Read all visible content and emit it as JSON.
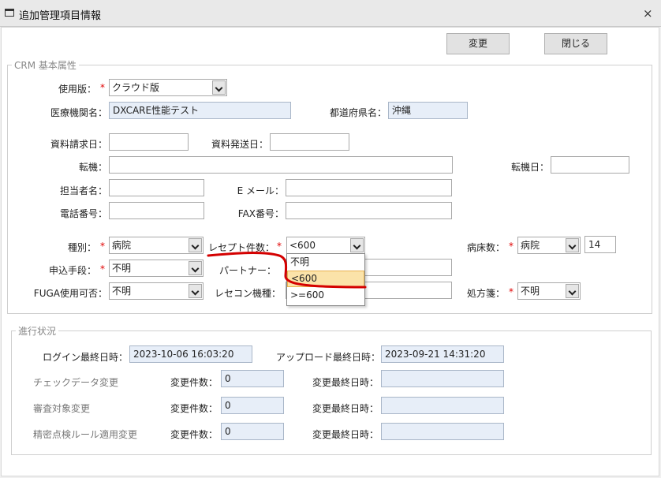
{
  "window": {
    "title": "追加管理項目情報",
    "close_icon": "×"
  },
  "toolbar": {
    "change_label": "変更",
    "close_label": "閉じる"
  },
  "crm": {
    "legend": "CRM 基本属性",
    "usage_label": "使用版：",
    "usage_value": "クラウド版",
    "institution_label": "医療機関名：",
    "institution_value": "DXCARE性能テスト",
    "prefecture_label": "都道府県名：",
    "prefecture_value": "沖縄",
    "doc_request_label": "資料請求日：",
    "doc_request_value": "",
    "doc_send_label": "資料発送日：",
    "doc_send_value": "",
    "transfer_label": "転機：",
    "transfer_value": "",
    "transfer_date_label": "転機日：",
    "transfer_date_value": "",
    "staff_label": "担当者名：",
    "staff_value": "",
    "email_label": "E メール：",
    "email_value": "",
    "phone_label": "電話番号：",
    "phone_value": "",
    "fax_label": "FAX番号：",
    "fax_value": "",
    "type_label": "種別：",
    "type_value": "病院",
    "receipt_label": "レセプト件数：",
    "receipt_value": "<600",
    "receipt_options": [
      "不明",
      "<600",
      ">=600"
    ],
    "beds_label": "病床数：",
    "beds_value": "病院",
    "beds_count": "14",
    "apply_label": "申込手段：",
    "apply_value": "不明",
    "partner_label": "パートナー：",
    "partner_value": "",
    "fuga_label": "FUGA使用可否：",
    "fuga_value": "不明",
    "rececom_label": "レセコン機種：",
    "rececom_value": "",
    "prescription_label": "処方箋：",
    "prescription_value": "不明",
    "required_mark": "*"
  },
  "progress": {
    "legend": "進行状況",
    "login_label": "ログイン最終日時：",
    "login_value": "2023-10-06 16:03:20",
    "upload_label": "アップロード最終日時：",
    "upload_value": "2023-09-21 14:31:20",
    "rows": [
      {
        "name": "チェックデータ変更",
        "count_label": "変更件数：",
        "count": "0",
        "date_label": "変更最終日時：",
        "date": ""
      },
      {
        "name": "審査対象変更",
        "count_label": "変更件数：",
        "count": "0",
        "date_label": "変更最終日時：",
        "date": ""
      },
      {
        "name": "精密点検ルール適用変更",
        "count_label": "変更件数：",
        "count": "0",
        "date_label": "変更最終日時：",
        "date": ""
      }
    ]
  },
  "colors": {
    "annotation": "#d40000",
    "required": "#e00000",
    "readonly_bg": "#e7eef8",
    "highlight_bg": "#fbe3a9"
  }
}
